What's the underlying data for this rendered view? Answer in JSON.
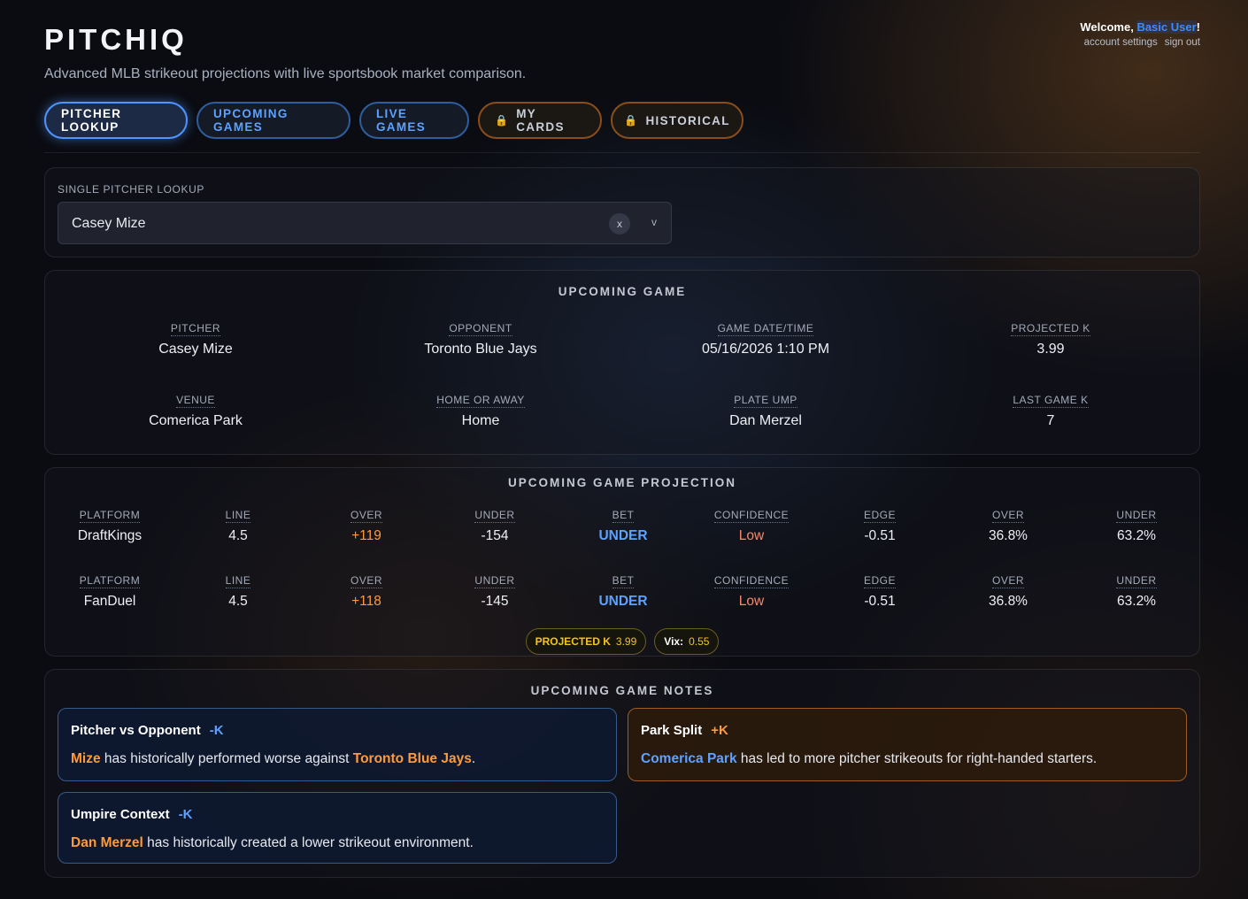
{
  "app": {
    "brand": "PITCHIQ",
    "tagline": "Advanced MLB strikeout projections with live sportsbook market comparison."
  },
  "user": {
    "welcome_prefix": "Welcome, ",
    "name": "Basic User",
    "welcome_suffix": "!",
    "account_settings": "account settings",
    "sign_out": "sign out"
  },
  "tabs": [
    {
      "label": "PITCHER LOOKUP",
      "active": true,
      "locked": false
    },
    {
      "label": "UPCOMING GAMES",
      "active": false,
      "locked": false
    },
    {
      "label": "LIVE GAMES",
      "active": false,
      "locked": false
    },
    {
      "label": "MY CARDS",
      "active": false,
      "locked": true
    },
    {
      "label": "HISTORICAL",
      "active": false,
      "locked": true
    }
  ],
  "lookup": {
    "label": "SINGLE PITCHER LOOKUP",
    "value": "Casey Mize",
    "clear": "x",
    "caret": "v"
  },
  "upcoming_game": {
    "title": "UPCOMING GAME",
    "fields": [
      {
        "label": "PITCHER",
        "value": "Casey Mize"
      },
      {
        "label": "OPPONENT",
        "value": "Toronto Blue Jays"
      },
      {
        "label": "GAME DATE/TIME",
        "value": "05/16/2026 1:10 PM"
      },
      {
        "label": "PROJECTED K",
        "value": "3.99"
      },
      {
        "label": "VENUE",
        "value": "Comerica Park"
      },
      {
        "label": "HOME OR AWAY",
        "value": "Home"
      },
      {
        "label": "PLATE UMP",
        "value": "Dan Merzel"
      },
      {
        "label": "LAST GAME K",
        "value": "7"
      }
    ]
  },
  "projection": {
    "title": "UPCOMING GAME PROJECTION",
    "headers": [
      "PLATFORM",
      "LINE",
      "OVER",
      "UNDER",
      "BET",
      "CONFIDENCE",
      "EDGE",
      "OVER",
      "UNDER"
    ],
    "rows": [
      [
        "DraftKings",
        "4.5",
        "+119",
        "-154",
        "UNDER",
        "Low",
        "-0.51",
        "36.8%",
        "63.2%"
      ],
      [
        "FanDuel",
        "4.5",
        "+118",
        "-145",
        "UNDER",
        "Low",
        "-0.51",
        "36.8%",
        "63.2%"
      ]
    ],
    "badges": {
      "projected_k_label": "PROJECTED K",
      "projected_k_value": "3.99",
      "vix_label": "Vix:",
      "vix_value": "0.55"
    }
  },
  "notes": {
    "title": "UPCOMING GAME NOTES",
    "items": [
      {
        "title": "Pitcher vs Opponent",
        "indicator": "-K",
        "hl1": "Mize",
        "text1": " has historically performed worse against ",
        "hl2": "Toronto Blue Jays",
        "text2": "."
      },
      {
        "title": "Park Split",
        "indicator": "+K",
        "hl1": "Comerica Park",
        "text1": " has led to more pitcher strikeouts for right-handed starters."
      },
      {
        "title": "Umpire Context",
        "indicator": "-K",
        "hl1": "Dan Merzel",
        "text1": " has historically created a lower strikeout environment."
      }
    ]
  },
  "colors": {
    "accent_blue": "#5ea2ff",
    "accent_orange": "#ff9a3c",
    "badge_gold": "#f5c518",
    "confidence_low": "#f48a6e"
  },
  "icons": {
    "lock": "lock-icon"
  }
}
